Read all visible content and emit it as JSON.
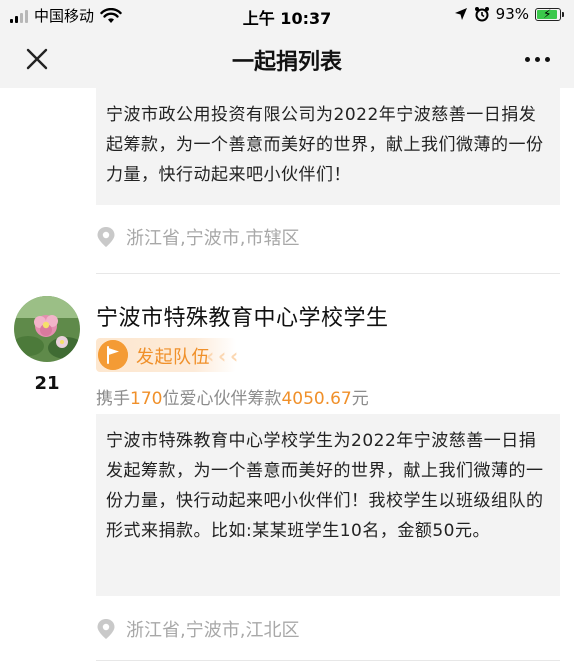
{
  "status_bar": {
    "carrier": "中国移动",
    "time": "上午 10:37",
    "battery_percent": "93%",
    "battery_level": 0.93
  },
  "nav": {
    "title": "一起捐列表",
    "close_icon": "close-icon",
    "more_icon": "more-icon"
  },
  "entries": [
    {
      "message": "宁波市政公用投资有限公司为2022年宁波慈善一日捐发起筹款，为一个善意而美好的世界，献上我们微薄的一份力量，快行动起来吧小伙伴们！",
      "location": "浙江省,宁波市,市辖区"
    },
    {
      "rank": "21",
      "name": "宁波市特殊教育中心学校学生",
      "badge": "发起队伍",
      "stats_prefix": "携手",
      "partner_count": "170",
      "stats_middle": "位爱心伙伴筹款",
      "amount": "4050.67",
      "stats_suffix": "元",
      "message": "宁波市特殊教育中心学校学生为2022年宁波慈善一日捐发起筹款，为一个善意而美好的世界，献上我们微薄的一份力量，快行动起来吧小伙伴们！我校学生以班级组队的形式来捐款。比如:某某班学生10名，金额50元。",
      "location": "浙江省,宁波市,江北区"
    }
  ],
  "colors": {
    "accent": "#f0902a",
    "badge_bg": "#fde7cf",
    "message_bg": "#f3f3f3",
    "muted": "#a8a8a8",
    "battery": "#3ac84b"
  }
}
